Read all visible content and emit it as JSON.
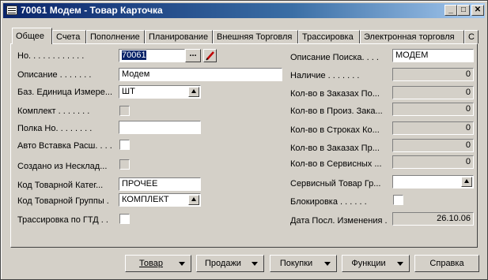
{
  "window": {
    "title": "70061 Модем - Товар Карточка"
  },
  "tabs": [
    "Общее",
    "Счета",
    "Пополнение",
    "Планирование",
    "Внешняя Торговля",
    "Трассировка",
    "Электронная торговля",
    "С"
  ],
  "left": {
    "no_label": "Но. . . . . . . . . . . .",
    "no_value": "70061",
    "no_lookup": "...",
    "description_label": "Описание . . . . . . .",
    "description_value": "Модем",
    "base_unit_label": "Баз. Единица Измере...",
    "base_unit_value": "ШТ",
    "kit_label": "Комплект . . . . . . .",
    "shelf_label": "Полка Но. . . . . . . .",
    "shelf_value": "",
    "auto_insert_label": "Авто Вставка Расш. . . .",
    "created_label": "Создано из Несклад...",
    "category_label": "Код Товарной Катег...",
    "category_value": "ПРОЧЕЕ",
    "group_label": "Код Товарной Группы .",
    "group_value": "КОМПЛЕКТ",
    "gtd_label": "Трассировка по ГТД . ."
  },
  "right": {
    "search_desc_label": "Описание Поиска. . . .",
    "search_desc_value": "МОДЕМ",
    "inventory_label": "Наличие . . . . . . .",
    "inventory_value": "0",
    "po_label": "Кол-во в Заказах По...",
    "po_value": "0",
    "prod_label": "Кол-во в Произ. Зака...",
    "prod_value": "0",
    "lines_label": "Кол-во в Строках Ко...",
    "lines_value": "0",
    "so_label": "Кол-во в Заказах Пр...",
    "so_value": "0",
    "service_label": "Кол-во в Сервисных ...",
    "service_value": "0",
    "service_group_label": "Сервисный Товар Гр...",
    "service_group_value": "",
    "blocked_label": "Блокировка . . . . . .",
    "last_change_label": "Дата Посл. Изменения .",
    "last_change_value": "26.10.06"
  },
  "buttons": {
    "item": "Товар",
    "sales": "Продажи",
    "purchases": "Покупки",
    "functions": "Функции",
    "help": "Справка"
  },
  "window_controls": {
    "minimize": "_",
    "maximize": "□",
    "close": "✕"
  }
}
